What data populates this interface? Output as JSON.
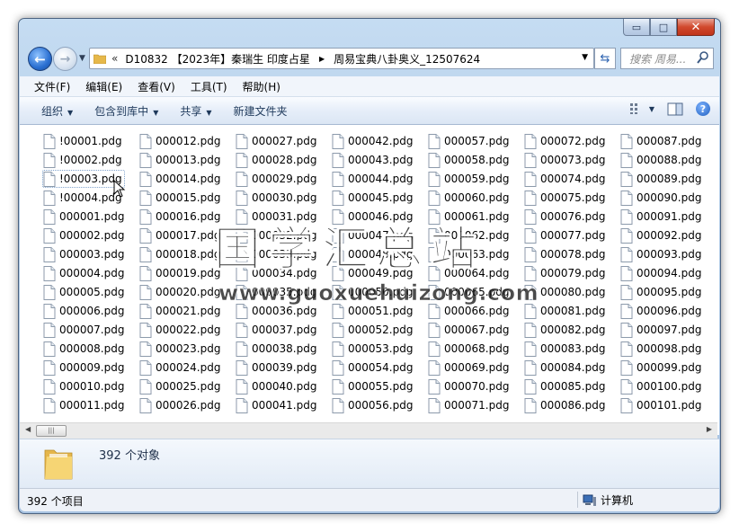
{
  "window": {
    "controls": {
      "minimize": "▭",
      "maximize": "□",
      "close": "✕"
    }
  },
  "nav": {
    "back_icon": "back-arrow-icon",
    "forward_icon": "forward-arrow-icon"
  },
  "address": {
    "overflow": "«",
    "segment_parent": "D10832 【2023年】秦瑞生 印度占星",
    "segment_current": "周易宝典八卦奥义_12507624"
  },
  "search": {
    "placeholder": "搜索 周易..."
  },
  "menu": [
    "文件(F)",
    "编辑(E)",
    "查看(V)",
    "工具(T)",
    "帮助(H)"
  ],
  "toolbar": {
    "organize": "组织",
    "include_library": "包含到库中",
    "share": "共享",
    "new_folder": "新建文件夹"
  },
  "files": [
    "!00001.pdg",
    "!00002.pdg",
    "!00003.pdg",
    "!00004.pdg",
    "000001.pdg",
    "000002.pdg",
    "000003.pdg",
    "000004.pdg",
    "000005.pdg",
    "000006.pdg",
    "000007.pdg",
    "000008.pdg",
    "000009.pdg",
    "000010.pdg",
    "000011.pdg",
    "000012.pdg",
    "000013.pdg",
    "000014.pdg",
    "000015.pdg",
    "000016.pdg",
    "000017.pdg",
    "000018.pdg",
    "000019.pdg",
    "000020.pdg",
    "000021.pdg",
    "000022.pdg",
    "000023.pdg",
    "000024.pdg",
    "000025.pdg",
    "000026.pdg",
    "000027.pdg",
    "000028.pdg",
    "000029.pdg",
    "000030.pdg",
    "000031.pdg",
    "000032.pdg",
    "000033.pdg",
    "000034.pdg",
    "000035.pdg",
    "000036.pdg",
    "000037.pdg",
    "000038.pdg",
    "000039.pdg",
    "000040.pdg",
    "000041.pdg",
    "000042.pdg",
    "000043.pdg",
    "000044.pdg",
    "000045.pdg",
    "000046.pdg",
    "000047.pdg",
    "000048.pdg",
    "000049.pdg",
    "000050.pdg",
    "000051.pdg",
    "000052.pdg",
    "000053.pdg",
    "000054.pdg",
    "000055.pdg",
    "000056.pdg",
    "000057.pdg",
    "000058.pdg",
    "000059.pdg",
    "000060.pdg",
    "000061.pdg",
    "000062.pdg",
    "000063.pdg",
    "000064.pdg",
    "000065.pdg",
    "000066.pdg",
    "000067.pdg",
    "000068.pdg",
    "000069.pdg",
    "000070.pdg",
    "000071.pdg",
    "000072.pdg",
    "000073.pdg",
    "000074.pdg",
    "000075.pdg",
    "000076.pdg",
    "000077.pdg",
    "000078.pdg",
    "000079.pdg",
    "000080.pdg",
    "000081.pdg",
    "000082.pdg",
    "000083.pdg",
    "000084.pdg",
    "000085.pdg",
    "000086.pdg",
    "000087.pdg",
    "000088.pdg",
    "000089.pdg",
    "000090.pdg",
    "000091.pdg",
    "000092.pdg",
    "000093.pdg",
    "000094.pdg",
    "000095.pdg",
    "000096.pdg",
    "000097.pdg",
    "000098.pdg",
    "000099.pdg",
    "000100.pdg",
    "000101.pdg"
  ],
  "focused_file": "!00003.pdg",
  "scroll": {
    "thumb_grip": "|||"
  },
  "details": {
    "object_count": "392 个对象"
  },
  "status": {
    "item_count": "392 个项目",
    "location": "计算机"
  },
  "watermark": {
    "text": "国学汇总站",
    "url": "www.guoxuehuizong.com"
  },
  "colors": {
    "folder": "#f0c75a",
    "accent": "#2a6fd1",
    "close": "#c0341b"
  }
}
